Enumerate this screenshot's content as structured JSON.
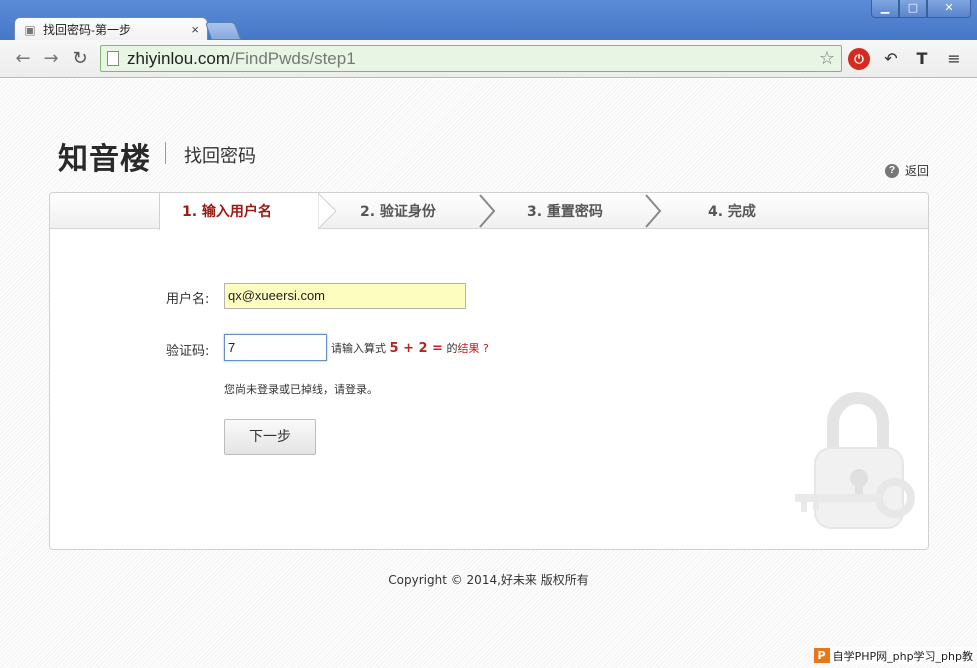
{
  "browser": {
    "tab_title": "找回密码-第一步",
    "tab_close": "×",
    "url_host": "zhiyinlou.com",
    "url_path": "/FindPwds/step1",
    "window_buttons": {
      "minimize": "▁",
      "maximize": "□",
      "close": "✕"
    },
    "icons": [
      "back-arrow-icon",
      "forward-arrow-icon",
      "reload-icon",
      "bookmark-star-icon",
      "adblock-icon",
      "undo-icon",
      "text-tool-icon",
      "menu-icon"
    ],
    "nav": {
      "back": "←",
      "forward": "→",
      "reload": "↻",
      "star": "☆",
      "ext1": "⏻",
      "ext2": "↶",
      "ext3": "T",
      "menu": "≡"
    }
  },
  "header": {
    "logo": "知音楼",
    "title": "找回密码",
    "back_link": "返回",
    "help_icon_glyph": "?"
  },
  "steps": [
    {
      "label": "1. 输入用户名",
      "active": true
    },
    {
      "label": "2. 验证身份",
      "active": false
    },
    {
      "label": "3. 重置密码",
      "active": false
    },
    {
      "label": "4. 完成",
      "active": false
    }
  ],
  "form": {
    "username_label": "用户名:",
    "username_value": "qx@xueersi.com",
    "captcha_label": "验证码:",
    "captcha_value": "7",
    "captcha_hint_prefix": "请输入算式",
    "captcha_expression": "5 + 2 =",
    "captcha_hint_mid": "的",
    "captcha_hint_suffix": "结果 ?",
    "login_message": "您尚未登录或已掉线，请登录。",
    "next_button": "下一步"
  },
  "footer": {
    "copyright": "Copyright © 2014,好未来 版权所有"
  },
  "watermark": {
    "logo_letter": "P",
    "text": "自学PHP网_php学习_php教"
  },
  "colors": {
    "accent_red": "#9b1a14",
    "captcha_red": "#c0211a",
    "username_field_bg": "#fdfdc0",
    "omnibox_bg": "#e8f5e4"
  }
}
